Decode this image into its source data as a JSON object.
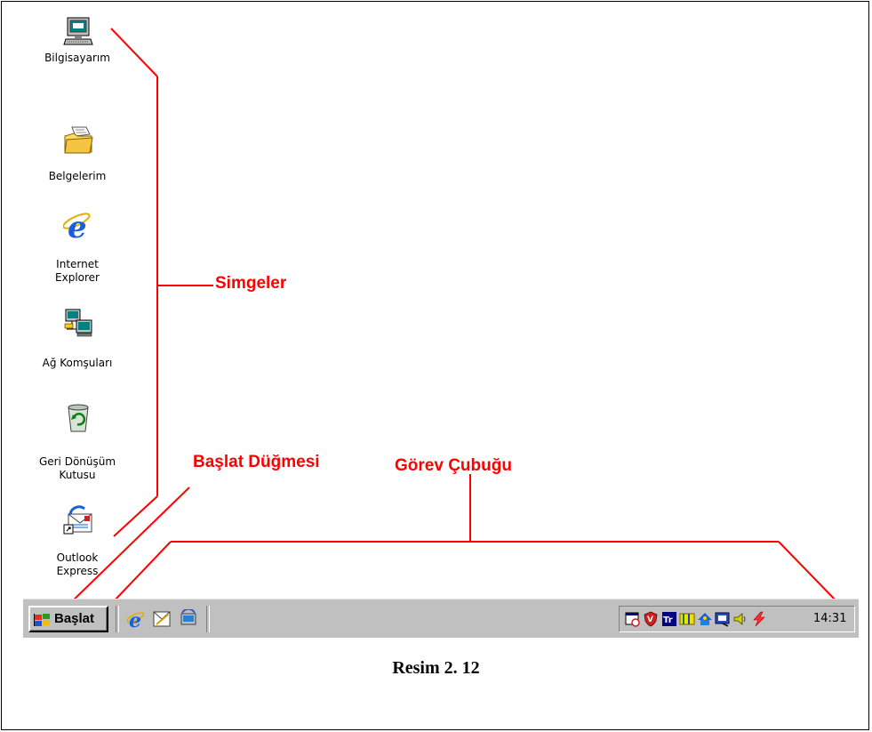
{
  "desktop_icons": [
    {
      "label": "Bilgisayarım",
      "icon": "my-computer-icon"
    },
    {
      "label": "Belgelerim",
      "icon": "my-documents-icon"
    },
    {
      "label": "Internet\nExplorer",
      "icon": "internet-explorer-icon"
    },
    {
      "label": "Ağ Komşuları",
      "icon": "network-neighborhood-icon"
    },
    {
      "label": "Geri Dönüşüm\nKutusu",
      "icon": "recycle-bin-icon"
    },
    {
      "label": "Outlook\nExpress",
      "icon": "outlook-express-icon"
    }
  ],
  "annotations": {
    "icons": "Simgeler",
    "start_button": "Başlat Düğmesi",
    "taskbar": "Görev Çubuğu",
    "color": "#ff0000"
  },
  "taskbar": {
    "start_label": "Başlat",
    "quick_launch": [
      "internet-explorer-icon",
      "outlook-express-icon",
      "show-desktop-icon"
    ],
    "tray_icons": [
      "scheduler-icon",
      "antivirus-icon",
      "language-tr-icon",
      "keyboard-icon",
      "network-icon",
      "display-icon",
      "volume-icon",
      "power-icon"
    ],
    "clock": "14:31"
  },
  "caption": "Resim 2. 12"
}
